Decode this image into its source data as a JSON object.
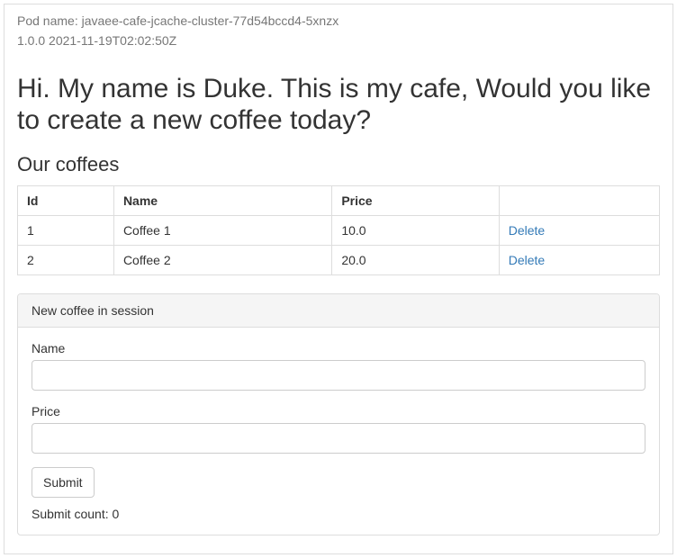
{
  "header": {
    "pod_label": "Pod name:",
    "pod_name": "javaee-cafe-jcache-cluster-77d54bccd4-5xnzx",
    "version": "1.0.0",
    "timestamp": "2021-11-19T02:02:50Z"
  },
  "main": {
    "title": "Hi. My name is Duke. This is my cafe, Would you like to create a new coffee today?",
    "subtitle": "Our coffees"
  },
  "table": {
    "headers": {
      "id": "Id",
      "name": "Name",
      "price": "Price",
      "actions": ""
    },
    "rows": [
      {
        "id": "1",
        "name": "Coffee 1",
        "price": "10.0",
        "delete": "Delete"
      },
      {
        "id": "2",
        "name": "Coffee 2",
        "price": "20.0",
        "delete": "Delete"
      }
    ]
  },
  "form": {
    "heading": "New coffee in session",
    "name_label": "Name",
    "name_value": "",
    "price_label": "Price",
    "price_value": "",
    "submit_label": "Submit",
    "submit_count_label": "Submit count:",
    "submit_count": "0"
  }
}
